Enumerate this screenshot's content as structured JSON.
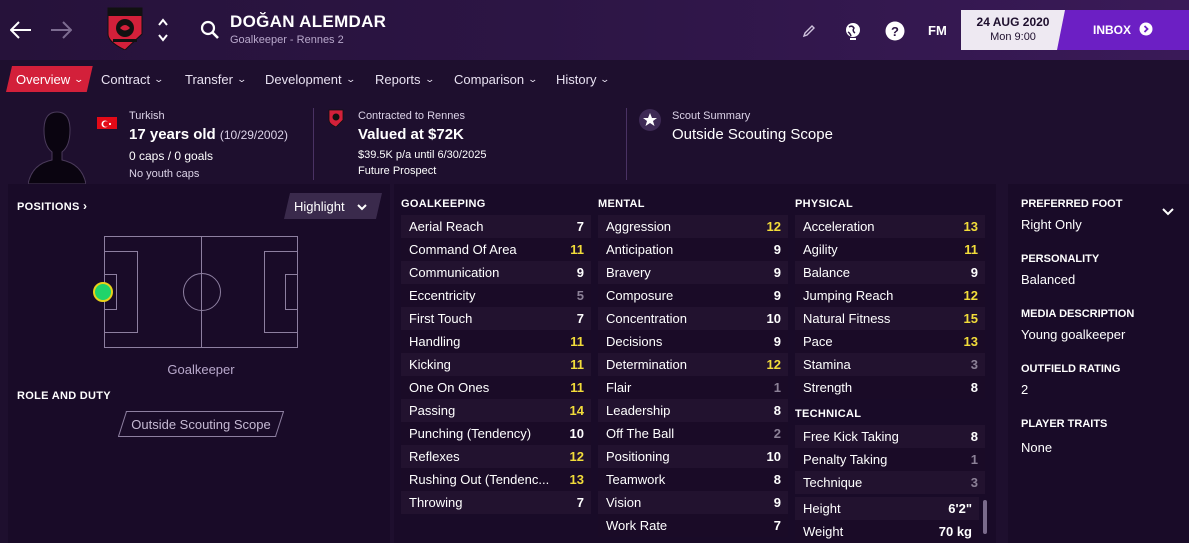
{
  "header": {
    "player_name": "DOĞAN ALEMDAR",
    "player_sub": "Goalkeeper - Rennes 2",
    "fm_label": "FM",
    "date": "24 AUG 2020",
    "time": "Mon 9:00",
    "inbox_label": "INBOX",
    "club_crest_icon": "rennes-crest-icon"
  },
  "tabs": [
    {
      "label": "Overview",
      "active": true
    },
    {
      "label": "Contract"
    },
    {
      "label": "Transfer"
    },
    {
      "label": "Development"
    },
    {
      "label": "Reports"
    },
    {
      "label": "Comparison"
    },
    {
      "label": "History"
    }
  ],
  "info": {
    "nationality": "Turkish",
    "age": "17 years old",
    "dob": "(10/29/2002)",
    "caps": "0 caps / 0 goals",
    "youth_caps": "No youth caps",
    "contract_label": "Contracted to Rennes",
    "value": "Valued at $72K",
    "wage": "$39.5K p/a until 6/30/2025",
    "status": "Future Prospect",
    "scout_label": "Scout Summary",
    "scout_value": "Outside Scouting Scope"
  },
  "positions": {
    "title": "POSITIONS",
    "highlight_label": "Highlight",
    "position_label": "Goalkeeper",
    "role_title": "ROLE AND DUTY",
    "role_value": "Outside Scouting Scope"
  },
  "goalkeeping": {
    "title": "GOALKEEPING",
    "rows": [
      {
        "name": "Aerial Reach",
        "value": "7",
        "tone": "white"
      },
      {
        "name": "Command Of Area",
        "value": "11",
        "tone": "yellow"
      },
      {
        "name": "Communication",
        "value": "9",
        "tone": "white"
      },
      {
        "name": "Eccentricity",
        "value": "5",
        "tone": "grey"
      },
      {
        "name": "First Touch",
        "value": "7",
        "tone": "white"
      },
      {
        "name": "Handling",
        "value": "11",
        "tone": "yellow"
      },
      {
        "name": "Kicking",
        "value": "11",
        "tone": "yellow"
      },
      {
        "name": "One On Ones",
        "value": "11",
        "tone": "yellow"
      },
      {
        "name": "Passing",
        "value": "14",
        "tone": "yellow"
      },
      {
        "name": "Punching (Tendency)",
        "value": "10",
        "tone": "white"
      },
      {
        "name": "Reflexes",
        "value": "12",
        "tone": "yellow"
      },
      {
        "name": "Rushing Out (Tendenc...",
        "value": "13",
        "tone": "yellow"
      },
      {
        "name": "Throwing",
        "value": "7",
        "tone": "white"
      }
    ]
  },
  "mental": {
    "title": "MENTAL",
    "rows": [
      {
        "name": "Aggression",
        "value": "12",
        "tone": "yellow"
      },
      {
        "name": "Anticipation",
        "value": "9",
        "tone": "white"
      },
      {
        "name": "Bravery",
        "value": "9",
        "tone": "white"
      },
      {
        "name": "Composure",
        "value": "9",
        "tone": "white"
      },
      {
        "name": "Concentration",
        "value": "10",
        "tone": "white"
      },
      {
        "name": "Decisions",
        "value": "9",
        "tone": "white"
      },
      {
        "name": "Determination",
        "value": "12",
        "tone": "yellow"
      },
      {
        "name": "Flair",
        "value": "1",
        "tone": "grey"
      },
      {
        "name": "Leadership",
        "value": "8",
        "tone": "white"
      },
      {
        "name": "Off The Ball",
        "value": "2",
        "tone": "grey"
      },
      {
        "name": "Positioning",
        "value": "10",
        "tone": "white"
      },
      {
        "name": "Teamwork",
        "value": "8",
        "tone": "white"
      },
      {
        "name": "Vision",
        "value": "9",
        "tone": "white"
      },
      {
        "name": "Work Rate",
        "value": "7",
        "tone": "white"
      }
    ]
  },
  "physical": {
    "title": "PHYSICAL",
    "rows": [
      {
        "name": "Acceleration",
        "value": "13",
        "tone": "yellow"
      },
      {
        "name": "Agility",
        "value": "11",
        "tone": "yellow"
      },
      {
        "name": "Balance",
        "value": "9",
        "tone": "white"
      },
      {
        "name": "Jumping Reach",
        "value": "12",
        "tone": "yellow"
      },
      {
        "name": "Natural Fitness",
        "value": "15",
        "tone": "yellow"
      },
      {
        "name": "Pace",
        "value": "13",
        "tone": "yellow"
      },
      {
        "name": "Stamina",
        "value": "3",
        "tone": "grey"
      },
      {
        "name": "Strength",
        "value": "8",
        "tone": "white"
      }
    ]
  },
  "technical": {
    "title": "TECHNICAL",
    "rows": [
      {
        "name": "Free Kick Taking",
        "value": "8",
        "tone": "white"
      },
      {
        "name": "Penalty Taking",
        "value": "1",
        "tone": "grey"
      },
      {
        "name": "Technique",
        "value": "3",
        "tone": "grey"
      }
    ]
  },
  "bio": {
    "rows": [
      {
        "name": "Height",
        "value": "6'2\""
      },
      {
        "name": "Weight",
        "value": "70 kg"
      }
    ]
  },
  "right_panel": {
    "preferred_foot_label": "PREFERRED FOOT",
    "preferred_foot": "Right Only",
    "personality_label": "PERSONALITY",
    "personality": "Balanced",
    "media_label": "MEDIA DESCRIPTION",
    "media": "Young goalkeeper",
    "outfield_label": "OUTFIELD RATING",
    "outfield": "2",
    "traits_label": "PLAYER TRAITS",
    "traits": "None"
  },
  "colors": {
    "accent_red": "#d3203a",
    "inbox_purple": "#6c1fc4",
    "highlight_yellow": "#f2dc3a",
    "gk_green": "#20d46a"
  }
}
